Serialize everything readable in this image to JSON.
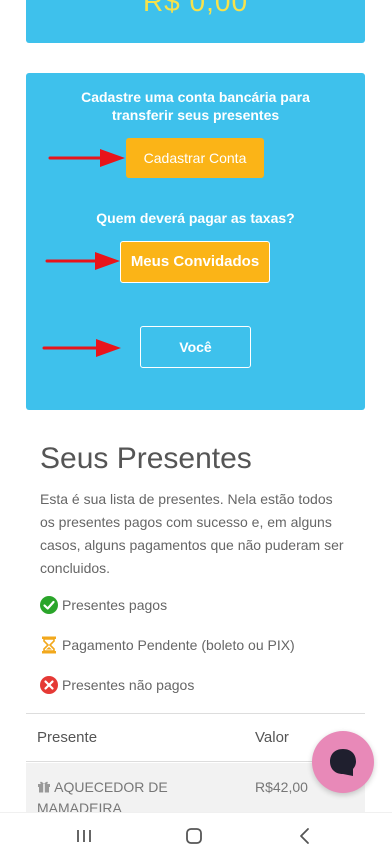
{
  "balance_card": {
    "amount": "R$ 0,00"
  },
  "bank_card": {
    "title": "Cadastre uma conta bancária para transferir seus presentes",
    "register_button": "Cadastrar Conta",
    "fees_question": "Quem deverá pagar as taxas?",
    "guests_button": "Meus Convidados",
    "you_button": "Você"
  },
  "presentes": {
    "title": "Seus Presentes",
    "description": "Esta é sua lista de presentes. Nela estão todos os presentes pagos com sucesso e, em alguns casos, alguns pagamentos que não puderam ser concluidos.",
    "legend": [
      {
        "icon": "check-circle-icon",
        "label": "Presentes pagos",
        "color": "#2aa52a"
      },
      {
        "icon": "hourglass-icon",
        "label": "Pagamento Pendente (boleto ou PIX)",
        "color": "#f2a81d"
      },
      {
        "icon": "x-circle-icon",
        "label": "Presentes não pagos",
        "color": "#e53935"
      }
    ]
  },
  "table": {
    "headers": {
      "presente": "Presente",
      "valor": "Valor"
    },
    "rows": [
      {
        "name": "AQUECEDOR DE MAMADEIRA",
        "value": "R$42,00",
        "icon": "gift-icon"
      }
    ]
  },
  "colors": {
    "card_blue": "#3ec1ec",
    "button_orange": "#fbb417",
    "arrow_red": "#e8141a",
    "chat_pink": "#e889b8"
  }
}
